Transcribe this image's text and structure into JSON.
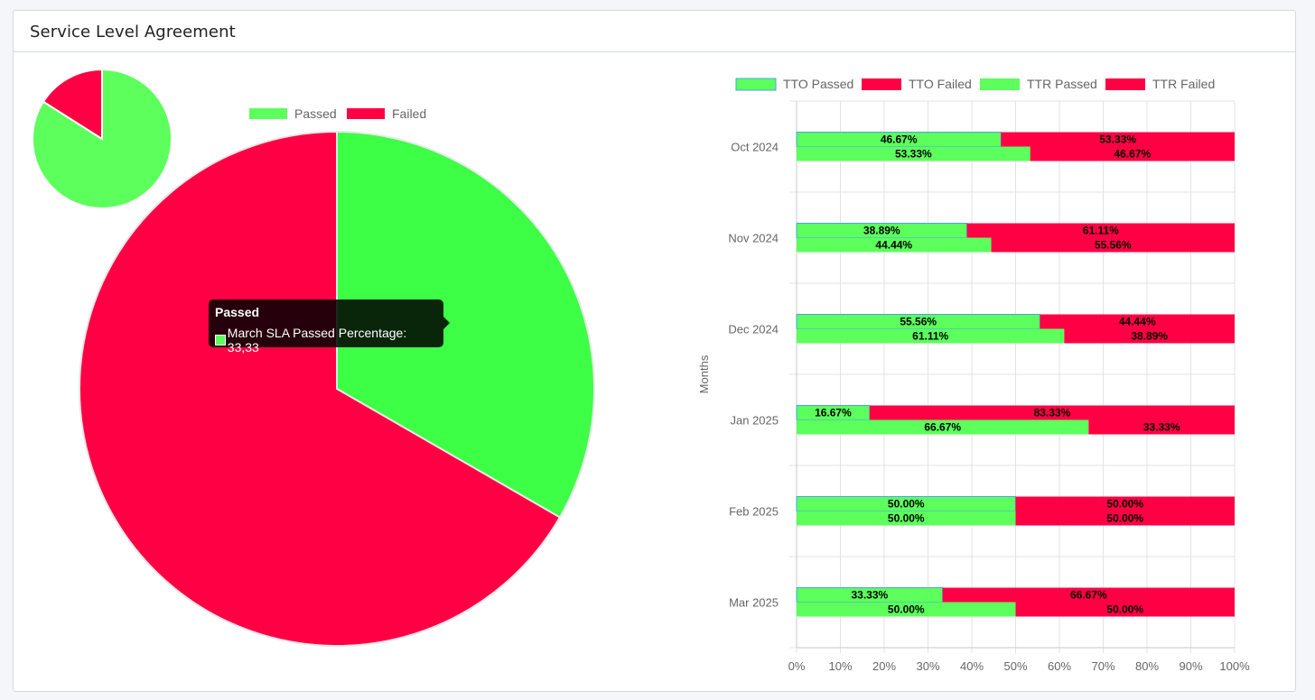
{
  "card": {
    "title": "Service Level Agreement"
  },
  "colors": {
    "passed": "#5cff5c",
    "passed_big": "#3dff45",
    "failed": "#ff0044",
    "tto_border": "#49a0f5"
  },
  "chart_data": [
    {
      "type": "pie",
      "labels": [
        "Passed",
        "Failed"
      ],
      "values": [
        84,
        16
      ],
      "legend": "none"
    },
    {
      "type": "pie",
      "labels": [
        "Passed",
        "Failed"
      ],
      "values": [
        33.33,
        66.67
      ],
      "legend": "top",
      "tooltip": {
        "title": "Passed",
        "body": "March SLA Passed Percentage: 33,33"
      }
    },
    {
      "type": "bar",
      "orientation": "horizontal",
      "stacked": true,
      "legend": "top",
      "categories": [
        "Oct 2024",
        "Nov 2024",
        "Dec 2024",
        "Jan 2025",
        "Feb 2025",
        "Mar 2025"
      ],
      "ylabel": "Months",
      "xlim": [
        0,
        100
      ],
      "xticks": [
        "0%",
        "10%",
        "20%",
        "30%",
        "40%",
        "50%",
        "60%",
        "70%",
        "80%",
        "90%",
        "100%"
      ],
      "series": [
        {
          "name": "TTO Passed",
          "values": [
            46.67,
            38.89,
            55.56,
            16.67,
            50.0,
            33.33
          ],
          "labels": [
            "46.67%",
            "38.89%",
            "55.56%",
            "16.67%",
            "50.00%",
            "33.33%"
          ]
        },
        {
          "name": "TTO Failed",
          "values": [
            53.33,
            61.11,
            44.44,
            83.33,
            50.0,
            66.67
          ],
          "labels": [
            "53.33%",
            "61.11%",
            "44.44%",
            "83.33%",
            "50.00%",
            "66.67%"
          ]
        },
        {
          "name": "TTR Passed",
          "values": [
            53.33,
            44.44,
            61.11,
            66.67,
            50.0,
            50.0
          ],
          "labels": [
            "53.33%",
            "44.44%",
            "61.11%",
            "66.67%",
            "50.00%",
            "50.00%"
          ]
        },
        {
          "name": "TTR Failed",
          "values": [
            46.67,
            55.56,
            38.89,
            33.33,
            50.0,
            50.0
          ],
          "labels": [
            "46.67%",
            "55.56%",
            "38.89%",
            "33.33%",
            "50.00%",
            "50.00%"
          ]
        }
      ],
      "grid": true
    }
  ]
}
